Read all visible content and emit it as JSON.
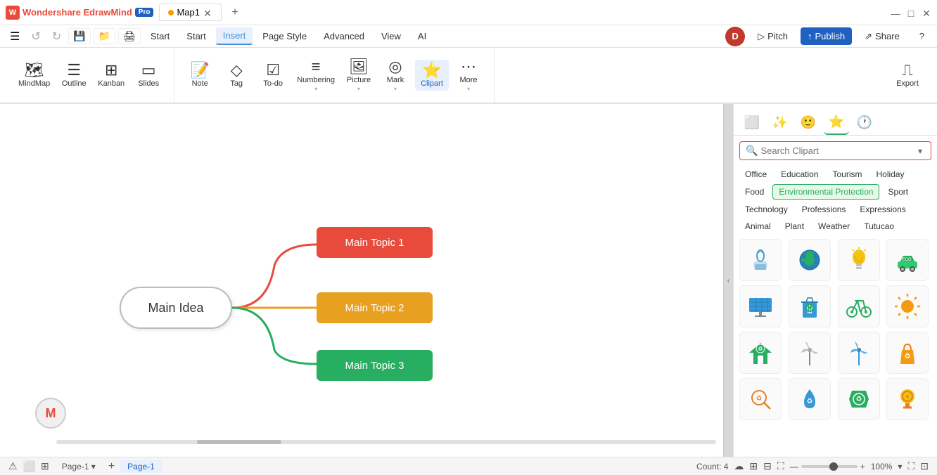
{
  "app": {
    "logo_text": "W",
    "brand": "Wondershare EdrawMind",
    "badge": "Pro",
    "tab_name": "Map1",
    "tab_dot_color": "#f90",
    "window_controls": [
      "—",
      "□",
      "✕"
    ]
  },
  "menu_bar": {
    "items": [
      {
        "id": "hamburger",
        "label": "☰"
      },
      {
        "id": "back",
        "label": "←"
      },
      {
        "id": "forward",
        "label": "→"
      },
      {
        "id": "file",
        "label": "File"
      }
    ],
    "tabs": [
      {
        "id": "start",
        "label": "Start",
        "active": false
      },
      {
        "id": "insert",
        "label": "Insert",
        "active": true
      },
      {
        "id": "page-style",
        "label": "Page Style",
        "active": false
      },
      {
        "id": "advanced",
        "label": "Advanced",
        "active": false
      },
      {
        "id": "view",
        "label": "View",
        "active": false
      },
      {
        "id": "ai",
        "label": "AI",
        "active": false
      }
    ]
  },
  "ribbon": {
    "groups": [
      {
        "id": "view-modes",
        "buttons": [
          {
            "id": "mindmap",
            "label": "MindMap",
            "icon": "🗺"
          },
          {
            "id": "outline",
            "label": "Outline",
            "icon": "☰"
          },
          {
            "id": "kanban",
            "label": "Kanban",
            "icon": "⊞"
          },
          {
            "id": "slides",
            "label": "Slides",
            "icon": "▭"
          }
        ]
      },
      {
        "id": "insert-tools",
        "buttons": [
          {
            "id": "note",
            "label": "Note",
            "icon": "📝"
          },
          {
            "id": "tag",
            "label": "Tag",
            "icon": "◇"
          },
          {
            "id": "todo",
            "label": "To-do",
            "icon": "☑"
          },
          {
            "id": "numbering",
            "label": "Numbering",
            "icon": "≡"
          },
          {
            "id": "picture",
            "label": "Picture",
            "icon": "🖼"
          },
          {
            "id": "mark",
            "label": "Mark",
            "icon": "◎"
          },
          {
            "id": "clipart",
            "label": "Clipart",
            "icon": "⭐",
            "active": true
          },
          {
            "id": "more",
            "label": "More",
            "icon": "⋯"
          }
        ]
      }
    ],
    "right_buttons": [
      {
        "id": "pitch",
        "label": "Pitch",
        "icon": "▷"
      },
      {
        "id": "publish",
        "label": "Publish",
        "icon": "↑",
        "style": "publish"
      },
      {
        "id": "share",
        "label": "Share",
        "icon": "⇗"
      },
      {
        "id": "help",
        "label": "?"
      },
      {
        "id": "export",
        "label": "Export",
        "icon": "⎍"
      }
    ],
    "user": {
      "initial": "D"
    }
  },
  "mindmap": {
    "main_idea": "Main Idea",
    "topics": [
      {
        "id": "topic1",
        "label": "Main Topic 1",
        "color": "#e84b3c"
      },
      {
        "id": "topic2",
        "label": "Main Topic 2",
        "color": "#e8a020"
      },
      {
        "id": "topic3",
        "label": "Main Topic 3",
        "color": "#27ae60"
      }
    ]
  },
  "clipart_panel": {
    "search_placeholder": "Search Clipart",
    "categories": [
      {
        "id": "office",
        "label": "Office",
        "active": false
      },
      {
        "id": "education",
        "label": "Education",
        "active": false
      },
      {
        "id": "tourism",
        "label": "Tourism",
        "active": false
      },
      {
        "id": "holiday",
        "label": "Holiday",
        "active": false
      },
      {
        "id": "food",
        "label": "Food",
        "active": false
      },
      {
        "id": "env-protection",
        "label": "Environmental Protection",
        "active": true
      },
      {
        "id": "sport",
        "label": "Sport",
        "active": false
      },
      {
        "id": "technology",
        "label": "Technology",
        "active": false
      },
      {
        "id": "professions",
        "label": "Professions",
        "active": false
      },
      {
        "id": "expressions",
        "label": "Expressions",
        "active": false
      },
      {
        "id": "animal",
        "label": "Animal",
        "active": false
      },
      {
        "id": "plant",
        "label": "Plant",
        "active": false
      },
      {
        "id": "weather",
        "label": "Weather",
        "active": false
      },
      {
        "id": "tutucao",
        "label": "Tutucao",
        "active": false
      }
    ],
    "icons": [
      {
        "id": "ic1",
        "glyph": "💧"
      },
      {
        "id": "ic2",
        "glyph": "🌍"
      },
      {
        "id": "ic3",
        "glyph": "💡"
      },
      {
        "id": "ic4",
        "glyph": "🚗"
      },
      {
        "id": "ic5",
        "glyph": "☀"
      },
      {
        "id": "ic6",
        "glyph": "🗑"
      },
      {
        "id": "ic7",
        "glyph": "🚲"
      },
      {
        "id": "ic8",
        "glyph": "🌞"
      },
      {
        "id": "ic9",
        "glyph": "🏠"
      },
      {
        "id": "ic10",
        "glyph": "🌀"
      },
      {
        "id": "ic11",
        "glyph": "🌬"
      },
      {
        "id": "ic12",
        "glyph": "🛍"
      },
      {
        "id": "ic13",
        "glyph": "🔍"
      },
      {
        "id": "ic14",
        "glyph": "💦"
      },
      {
        "id": "ic15",
        "glyph": "♻"
      },
      {
        "id": "ic16",
        "glyph": "🏅"
      }
    ],
    "tabs": [
      {
        "id": "shapes",
        "icon": "⬜",
        "label": "Shapes"
      },
      {
        "id": "smart",
        "icon": "✨",
        "label": "Smart"
      },
      {
        "id": "emoji",
        "icon": "🙂",
        "label": "Emoji"
      },
      {
        "id": "clipart",
        "icon": "⭐",
        "label": "Clipart",
        "active": true
      },
      {
        "id": "sticker",
        "icon": "🕐",
        "label": "Sticker"
      }
    ]
  },
  "status_bar": {
    "page_label": "Page-1",
    "page_tab": "Page-1",
    "count_label": "Count: 4",
    "zoom_level": "100%",
    "zoom_min": "—",
    "zoom_plus": "+"
  }
}
